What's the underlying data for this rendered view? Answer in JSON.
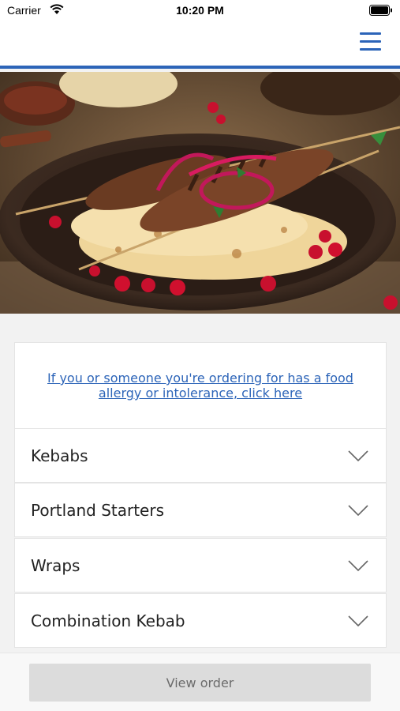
{
  "status_bar": {
    "carrier": "Carrier",
    "time": "10:20 PM",
    "wifi_icon": "wifi-icon",
    "battery_icon": "battery-icon"
  },
  "nav": {
    "menu_icon": "hamburger-menu-icon",
    "accent_color": "#2c64b8"
  },
  "hero": {
    "image": "kebab-flatbread-photo"
  },
  "allergy_notice": {
    "text": "If you or someone you're ordering for has a food allergy or intolerance, click here"
  },
  "categories": [
    {
      "label": "Kebabs"
    },
    {
      "label": "Portland Starters"
    },
    {
      "label": "Wraps"
    },
    {
      "label": "Combination Kebab"
    }
  ],
  "footer": {
    "view_order_label": "View order"
  }
}
